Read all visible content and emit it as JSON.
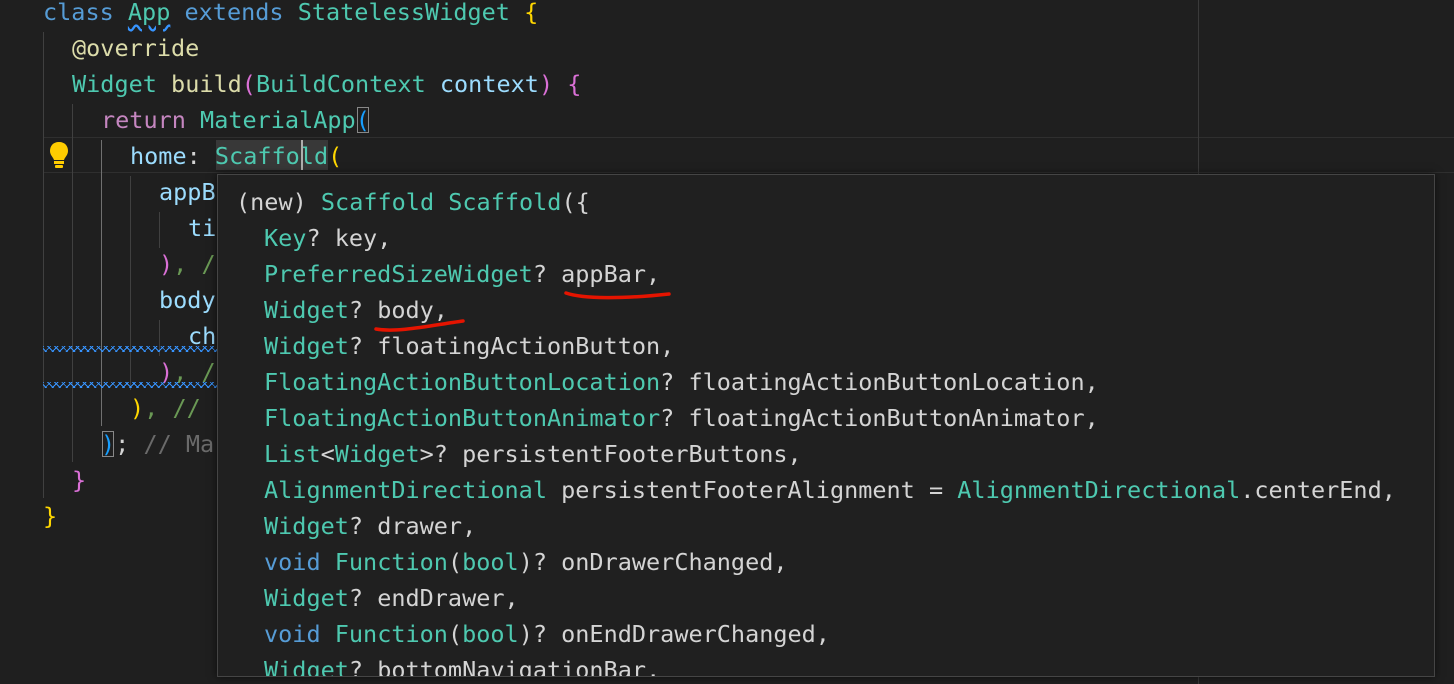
{
  "code": {
    "line1": {
      "kw": "class",
      "name": "App",
      "ext": "extends",
      "base": "StatelessWidget",
      "brace": "{"
    },
    "line2": {
      "annotation": "@override"
    },
    "line3": {
      "type": "Widget",
      "fn": "build",
      "open": "(",
      "ptype": "BuildContext",
      "param": "context",
      "close": ")",
      "brace": "{"
    },
    "line4": {
      "kw": "return",
      "fn": "MaterialApp",
      "open": "("
    },
    "line5": {
      "param": "home",
      "colon": ":",
      "fn": "Scaffold",
      "open": "("
    },
    "line6": {
      "text": "appB"
    },
    "line7": {
      "text": "ti"
    },
    "line8": {
      "close": ")",
      "rest": ", /"
    },
    "line9": {
      "text": "body"
    },
    "line10": {
      "text": "ch"
    },
    "line11": {
      "close": ")",
      "rest": ", /"
    },
    "line12": {
      "close": ")",
      "rest": ", //"
    },
    "line13": {
      "close": ")",
      "semi": ";",
      "comment": "// Ma"
    },
    "line14": {
      "brace": "}"
    },
    "line15": {
      "brace": "}"
    }
  },
  "hover": {
    "signature": {
      "prefix": "(new)",
      "type": "Scaffold",
      "name": "Scaffold",
      "open": "({"
    },
    "params": [
      {
        "kw": "",
        "type": "Key",
        "suffix": "? ",
        "name": "key,"
      },
      {
        "kw": "",
        "type": "PreferredSizeWidget",
        "suffix": "? ",
        "name": "appBar,"
      },
      {
        "kw": "",
        "type": "Widget",
        "suffix": "? ",
        "name": "body,"
      },
      {
        "kw": "",
        "type": "Widget",
        "suffix": "? ",
        "name": "floatingActionButton,"
      },
      {
        "kw": "",
        "type": "FloatingActionButtonLocation",
        "suffix": "? ",
        "name": "floatingActionButtonLocation,"
      },
      {
        "kw": "",
        "type": "FloatingActionButtonAnimator",
        "suffix": "? ",
        "name": "floatingActionButtonAnimator,"
      },
      {
        "kw": "",
        "type": "List",
        "suffix": "<",
        "type2": "Widget",
        "suffix2": ">? ",
        "name": "persistentFooterButtons,"
      },
      {
        "kw": "",
        "type": "AlignmentDirectional",
        "suffix": " ",
        "name": "persistentFooterAlignment = ",
        "type2": "AlignmentDirectional",
        "suffix2": ".centerEnd,"
      },
      {
        "kw": "",
        "type": "Widget",
        "suffix": "? ",
        "name": "drawer,"
      },
      {
        "kw": "void",
        "type": "Function",
        "suffix": "(",
        "type2": "bool",
        "suffix2": ")? ",
        "name": "onDrawerChanged,"
      },
      {
        "kw": "",
        "type": "Widget",
        "suffix": "? ",
        "name": "endDrawer,"
      },
      {
        "kw": "void",
        "type": "Function",
        "suffix": "(",
        "type2": "bool",
        "suffix2": ")? ",
        "name": "onEndDrawerChanged,"
      },
      {
        "kw": "",
        "type": "Widget",
        "suffix": "? ",
        "name": "bottomNavigationBar,"
      }
    ]
  },
  "colors": {
    "background": "#1f1f1f",
    "keyword": "#569cd6",
    "control_keyword": "#c586c0",
    "type": "#4ec9b0",
    "function": "#dcdcaa",
    "parameter": "#9cdcfe",
    "annotation_mark": "#e51400"
  },
  "icons": [
    "lightbulb-icon"
  ]
}
